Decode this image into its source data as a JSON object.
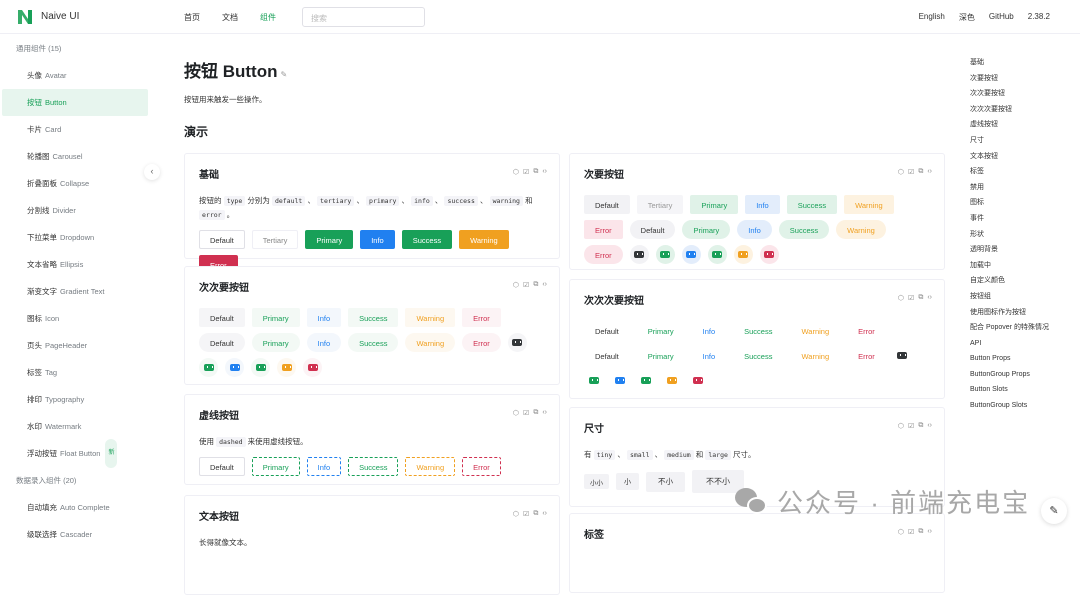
{
  "header": {
    "brand": "Naive UI",
    "nav": [
      "首页",
      "文档",
      "组件"
    ],
    "active_nav": "组件",
    "search_placeholder": "搜索",
    "right_nav": [
      "English",
      "深色",
      "GitHub",
      "2.38.2"
    ],
    "accent_color": "#18a058"
  },
  "sidebar": {
    "groups": [
      {
        "label": "通用组件 (15)"
      },
      {
        "label": "数据录入组件 (20)"
      }
    ],
    "items_general": [
      {
        "zh": "头像",
        "en": "Avatar"
      },
      {
        "zh": "按钮",
        "en": "Button",
        "active": true
      },
      {
        "zh": "卡片",
        "en": "Card"
      },
      {
        "zh": "轮播图",
        "en": "Carousel"
      },
      {
        "zh": "折叠面板",
        "en": "Collapse"
      },
      {
        "zh": "分割线",
        "en": "Divider"
      },
      {
        "zh": "下拉菜单",
        "en": "Dropdown"
      },
      {
        "zh": "文本省略",
        "en": "Ellipsis"
      },
      {
        "zh": "渐变文字",
        "en": "Gradient Text"
      },
      {
        "zh": "图标",
        "en": "Icon"
      },
      {
        "zh": "页头",
        "en": "PageHeader"
      },
      {
        "zh": "标签",
        "en": "Tag"
      },
      {
        "zh": "排印",
        "en": "Typography"
      },
      {
        "zh": "水印",
        "en": "Watermark"
      },
      {
        "zh": "浮动按钮",
        "en": "Float Button",
        "badge": "新"
      }
    ],
    "items_input": [
      {
        "zh": "自动填充",
        "en": "Auto Complete"
      },
      {
        "zh": "级联选择",
        "en": "Cascader"
      }
    ]
  },
  "main": {
    "title": "按钮 Button",
    "description": "按钮用来触发一些操作。",
    "demo_heading": "演示",
    "cards": {
      "basic": {
        "title": "基础",
        "desc_parts": [
          "按钮的",
          "type",
          "分别为",
          "default",
          "、",
          "tertiary",
          "、",
          "primary",
          "、",
          "info",
          "、",
          "success",
          "、",
          "warning",
          "和",
          "error",
          "。"
        ],
        "buttons": [
          "Default",
          "Tertiary",
          "Primary",
          "Info",
          "Success",
          "Warning",
          "Error"
        ]
      },
      "tertiary": {
        "title": "次次要按钮",
        "row1": [
          "Default",
          "Primary",
          "Info",
          "Success",
          "Warning",
          "Error",
          "Default"
        ],
        "row2": [
          "Primary",
          "Info",
          "Success",
          "Warning",
          "Error"
        ]
      },
      "dashed": {
        "title": "虚线按钮",
        "desc_pre": "使用",
        "desc_code": "dashed",
        "desc_post": "来使用虚线按钮。",
        "buttons": [
          "Default",
          "Primary",
          "Info",
          "Success",
          "Warning",
          "Error"
        ]
      },
      "text": {
        "title": "文本按钮",
        "desc": "长得就像文本。"
      },
      "secondary": {
        "title": "次要按钮",
        "row1": [
          "Default",
          "Tertiary",
          "Primary",
          "Info",
          "Success",
          "Warning",
          "Error"
        ],
        "row2": [
          "Default",
          "Primary",
          "Info",
          "Success",
          "Warning",
          "Error"
        ]
      },
      "quaternary": {
        "title": "次次次要按钮",
        "row1": [
          "Default",
          "Primary",
          "Info",
          "Success",
          "Warning",
          "Error",
          "Default"
        ],
        "row2": [
          "Primary",
          "Info",
          "Success",
          "Warning",
          "Error"
        ]
      },
      "size": {
        "title": "尺寸",
        "desc_parts": [
          "有",
          "tiny",
          "、",
          "small",
          "、",
          "medium",
          "和",
          "large",
          "尺寸。"
        ],
        "buttons": [
          "小小",
          "小",
          "不小",
          "不不小"
        ]
      },
      "tag": {
        "title": "标签"
      }
    }
  },
  "toc": [
    "基础",
    "次要按钮",
    "次次要按钮",
    "次次次要按钮",
    "虚线按钮",
    "尺寸",
    "文本按钮",
    "标签",
    "禁用",
    "图标",
    "事件",
    "形状",
    "透明背景",
    "加载中",
    "自定义颜色",
    "按钮组",
    "使用图标作为按钮",
    "配合 Popover 的特殊情况",
    "API",
    "Button Props",
    "ButtonGroup Props",
    "Button Slots",
    "ButtonGroup Slots"
  ],
  "watermark": "公众号 · 前端充电宝",
  "colors": {
    "primary": "#18a058",
    "info": "#2080f0",
    "success": "#18a058",
    "warning": "#f0a020",
    "error": "#d03050"
  }
}
